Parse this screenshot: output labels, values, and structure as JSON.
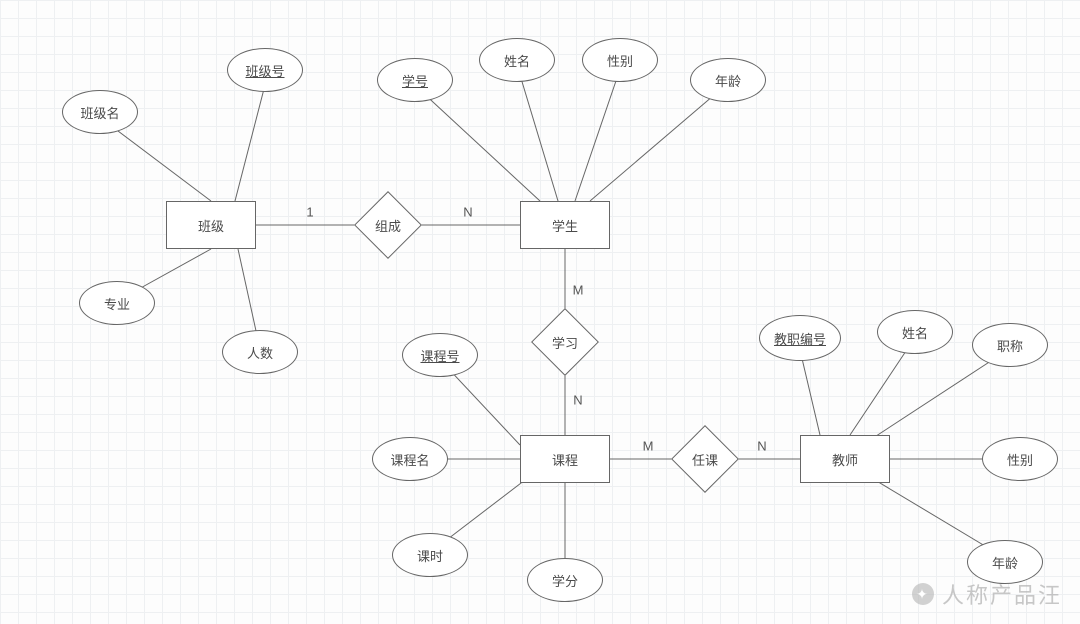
{
  "entities": {
    "class": {
      "label": "班级"
    },
    "student": {
      "label": "学生"
    },
    "course": {
      "label": "课程"
    },
    "teacher": {
      "label": "教师"
    }
  },
  "relationships": {
    "compose": {
      "label": "组成",
      "left_card": "1",
      "right_card": "N"
    },
    "study": {
      "label": "学习",
      "top_card": "M",
      "bottom_card": "N"
    },
    "teach": {
      "label": "任课",
      "left_card": "M",
      "right_card": "N"
    }
  },
  "attributes": {
    "class": {
      "class_id": "班级号",
      "class_name": "班级名",
      "major": "专业",
      "count": "人数"
    },
    "student": {
      "student_id": "学号",
      "name": "姓名",
      "gender": "性别",
      "age": "年龄"
    },
    "course": {
      "course_id": "课程号",
      "course_name": "课程名",
      "hours": "课时",
      "credit": "学分"
    },
    "teacher": {
      "teacher_id": "教职编号",
      "name": "姓名",
      "title": "职称",
      "gender": "性别",
      "age": "年龄"
    }
  },
  "keys": [
    "attributes.class.class_id",
    "attributes.student.student_id",
    "attributes.course.course_id",
    "attributes.teacher.teacher_id"
  ],
  "watermark": "人称产品汪"
}
